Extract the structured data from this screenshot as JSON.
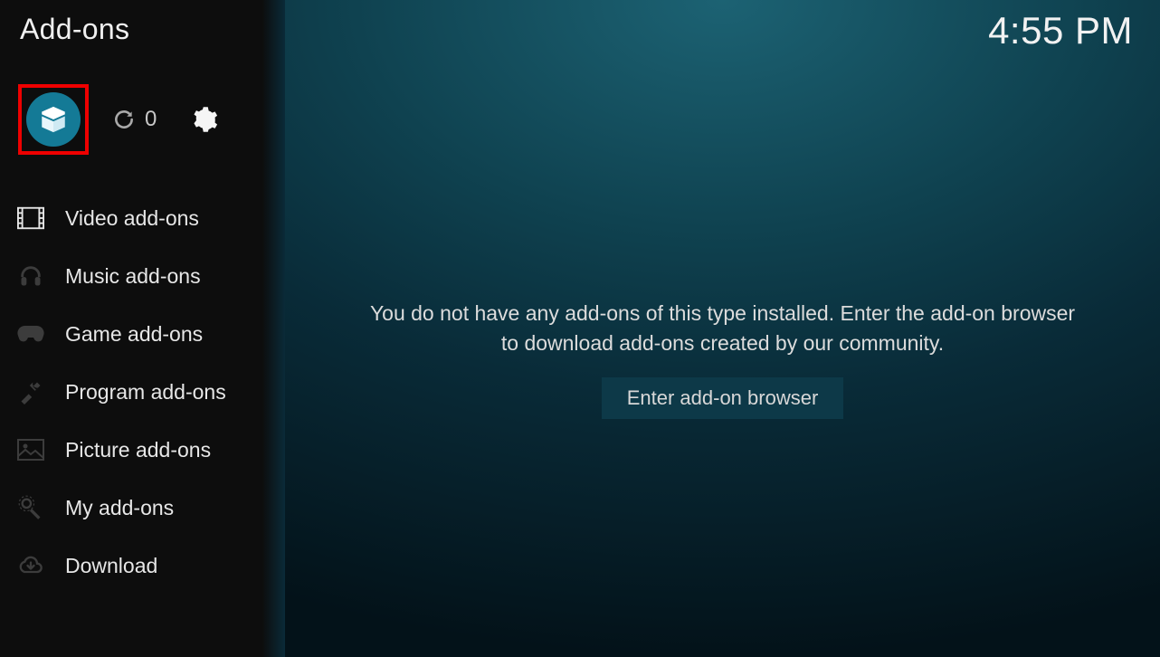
{
  "header": {
    "title": "Add-ons",
    "clock": "4:55 PM"
  },
  "toolbar": {
    "refresh_count": "0"
  },
  "sidebar": {
    "items": [
      {
        "label": "Video add-ons",
        "icon": "film",
        "active": true
      },
      {
        "label": "Music add-ons",
        "icon": "headphones",
        "active": false
      },
      {
        "label": "Game add-ons",
        "icon": "gamepad",
        "active": false
      },
      {
        "label": "Program add-ons",
        "icon": "tools",
        "active": false
      },
      {
        "label": "Picture add-ons",
        "icon": "picture",
        "active": false
      },
      {
        "label": "My add-ons",
        "icon": "gear-wrench",
        "active": false
      },
      {
        "label": "Download",
        "icon": "download",
        "active": false
      }
    ]
  },
  "main": {
    "empty_message": "You do not have any add-ons of this type installed. Enter the add-on browser to download add-ons created by our community.",
    "browser_button": "Enter add-on browser"
  }
}
